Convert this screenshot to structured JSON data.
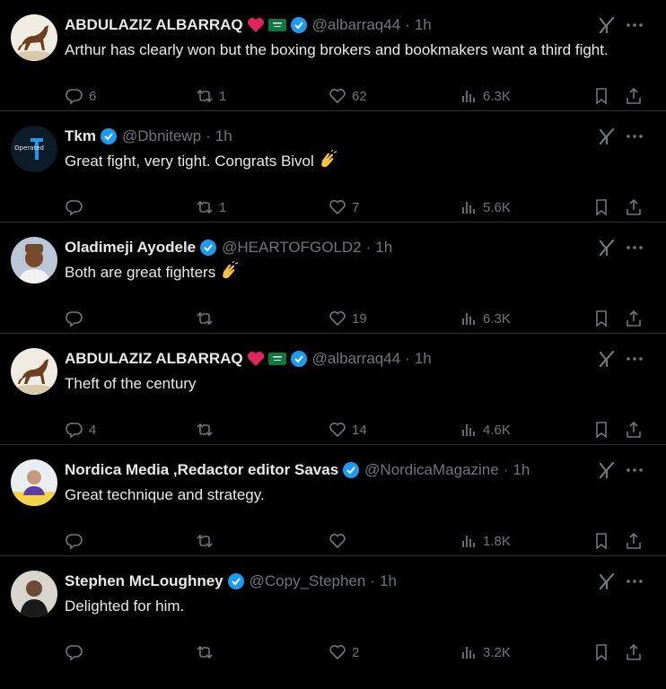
{
  "tweets": [
    {
      "name": "ABDULAZIZ ALBARRAQ",
      "has_heart": true,
      "has_flag": true,
      "handle": "@albarraq44",
      "time": "1h",
      "text": "Arthur has clearly won but the boxing brokers and bookmakers want a third fight.",
      "clap": false,
      "replies": "6",
      "retweets": "1",
      "likes": "62",
      "views": "6.3K",
      "avatar": "horse"
    },
    {
      "name": "Tkm",
      "has_heart": false,
      "has_flag": false,
      "handle": "@Dbnitewp",
      "time": "1h",
      "text": "Great fight, very tight. Congrats Bivol",
      "clap": true,
      "replies": "",
      "retweets": "1",
      "likes": "7",
      "views": "5.6K",
      "avatar": "operated",
      "avatar_label": "Operated"
    },
    {
      "name": "Oladimeji Ayodele",
      "has_heart": false,
      "has_flag": false,
      "handle": "@HEARTOFGOLD2",
      "time": "1h",
      "text": "Both are great fighters",
      "clap": true,
      "replies": "",
      "retweets": "",
      "likes": "19",
      "views": "6.3K",
      "avatar": "person-cap"
    },
    {
      "name": "ABDULAZIZ ALBARRAQ",
      "has_heart": true,
      "has_flag": true,
      "handle": "@albarraq44",
      "time": "1h",
      "text": "Theft of the century",
      "clap": false,
      "replies": "4",
      "retweets": "",
      "likes": "14",
      "views": "4.6K",
      "avatar": "horse"
    },
    {
      "name": "Nordica Media ,Redactor editor Savas",
      "has_heart": false,
      "has_flag": false,
      "handle": "@NordicaMagazine",
      "time": "1h",
      "text": "Great technique and strategy.",
      "clap": false,
      "replies": "",
      "retweets": "",
      "likes": "",
      "views": "1.8K",
      "avatar": "person-desk"
    },
    {
      "name": "Stephen McLoughney",
      "has_heart": false,
      "has_flag": false,
      "handle": "@Copy_Stephen",
      "time": "1h",
      "text": "Delighted for him.",
      "clap": false,
      "replies": "",
      "retweets": "",
      "likes": "2",
      "views": "3.2K",
      "avatar": "person-dark"
    }
  ],
  "separator": "·",
  "colors": {
    "verified": "#1d9bf0",
    "muted": "#71767b",
    "text": "#e7e9ea",
    "border": "#2f3336"
  }
}
